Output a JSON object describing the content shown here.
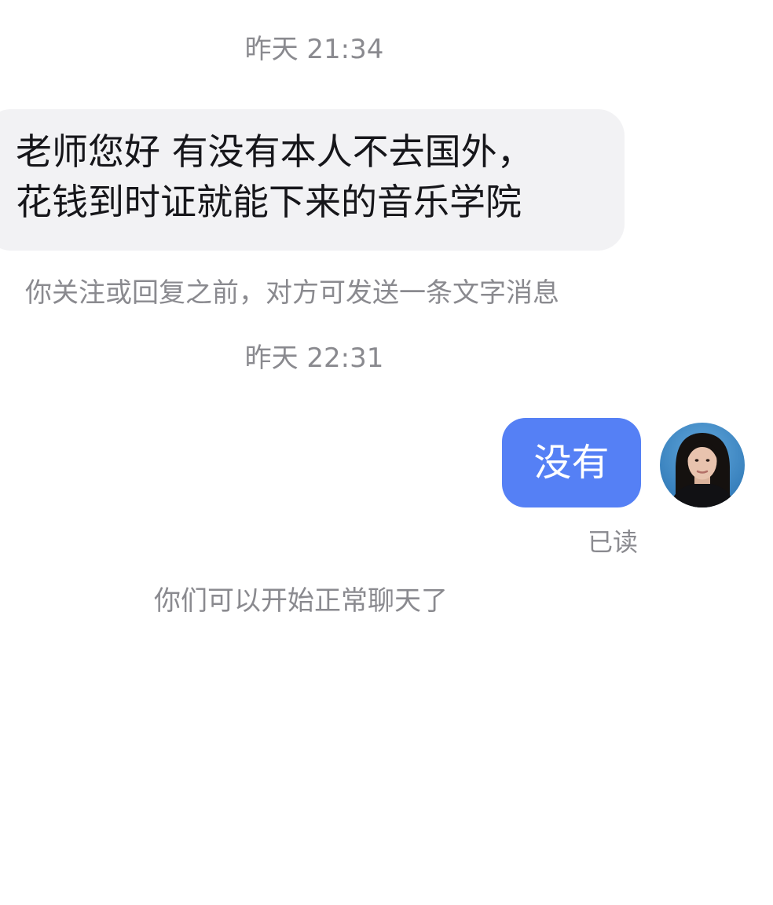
{
  "chat": {
    "timestamps": [
      "昨天 21:34",
      "昨天 22:31"
    ],
    "incoming_message": {
      "lines": [
        "老师您好 有没有本人不去国外，",
        "花钱到时证就能下来的音乐学院"
      ]
    },
    "system_note_follow": "你关注或回复之前，对方可发送一条文字消息",
    "outgoing_message": {
      "text": "没有",
      "status": "已读",
      "avatar": "avatar-photo"
    },
    "system_note_chat_open": "你们可以开始正常聊天了"
  },
  "colors": {
    "background": "#ffffff",
    "incoming_bubble": "#f2f2f4",
    "outgoing_bubble": "#5580f5",
    "meta_text": "#8a8a8f",
    "message_text": "#16161a"
  }
}
